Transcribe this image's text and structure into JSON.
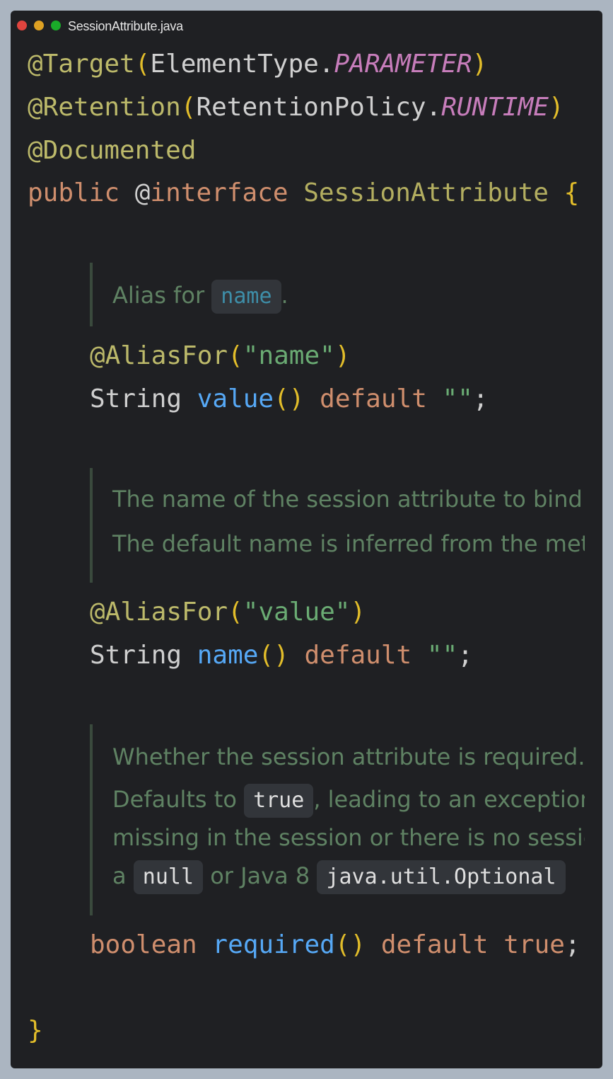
{
  "window": {
    "title": "SessionAttribute.java"
  },
  "code": {
    "l1": {
      "annot": "@Target",
      "open": "(",
      "cls": "ElementType.",
      "const": "PARAMETER",
      "close": ")"
    },
    "l2": {
      "annot": "@Retention",
      "open": "(",
      "cls": "RetentionPolicy.",
      "const": "RUNTIME",
      "close": ")"
    },
    "l3": {
      "annot": "@Documented"
    },
    "l4": {
      "kw": "public",
      "annot": "@",
      "iface_kw": "interface",
      "name": "SessionAttribute",
      "brace": "{"
    },
    "doc1": {
      "text": "Alias for ",
      "chip": "name",
      "tail": "."
    },
    "l5": {
      "annot": "@AliasFor",
      "open": "(",
      "str": "\"name\"",
      "close": ")"
    },
    "l6": {
      "type": "String",
      "method": "value",
      "parens": "()",
      "kw": "default",
      "str": "\"\"",
      "semi": ";"
    },
    "doc2": {
      "line1": "The name of the session attribute to bind to.",
      "line2": "The default name is inferred from the method parameter name."
    },
    "l7": {
      "annot": "@AliasFor",
      "open": "(",
      "str": "\"value\"",
      "close": ")"
    },
    "l8": {
      "type": "String",
      "method": "name",
      "parens": "()",
      "kw": "default",
      "str": "\"\"",
      "semi": ";"
    },
    "doc3": {
      "line1": "Whether the session attribute is required.",
      "line2_a": "Defaults to ",
      "line2_chip": "true",
      "line2_b": ", leading to an exception being thrown if the attribute is",
      "line3": "missing in the session or there is no session. Switch this to false if you prefer",
      "line4_a": "a ",
      "line4_chip1": "null",
      "line4_b": " or Java 8 ",
      "line4_chip2": "java.util.Optional"
    },
    "l9": {
      "type": "boolean",
      "method": "required",
      "parens": "()",
      "kw": "default",
      "value": "true",
      "semi": ";"
    },
    "closing": "}"
  },
  "colors": {
    "background": "#1f2023",
    "annotation": "#bcb96a",
    "keyword": "#cf8e6d",
    "string": "#6aab73",
    "method": "#56a8f5",
    "constant": "#c77dbb",
    "bracket": "#e2bd2a",
    "doc": "#5f8263"
  }
}
